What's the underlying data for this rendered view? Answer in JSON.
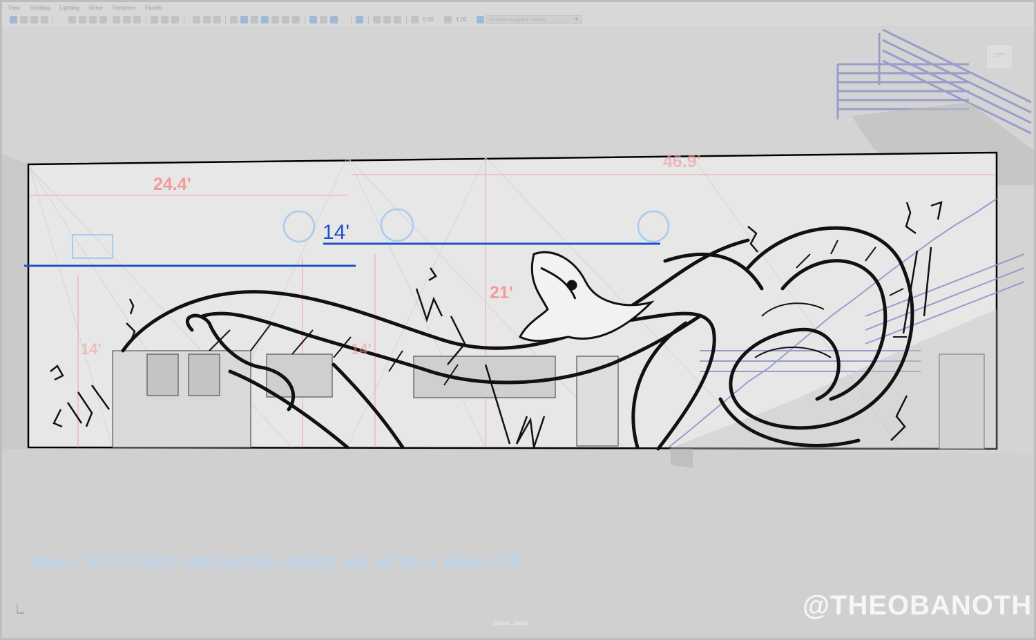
{
  "menubar": {
    "items": [
      "View",
      "Shading",
      "Lighting",
      "Show",
      "Renderer",
      "Panels"
    ]
  },
  "toolbar": {
    "exposure_value": "0.00",
    "gamma_value": "1.00",
    "color_space": "Un-tone-mapped (sRGB)"
  },
  "viewport": {
    "view_cube_label": "LEFT",
    "panel_label": "Isolate : persp",
    "dimensions": {
      "width_left": "24.4'",
      "width_right": "46.9'",
      "height_center": "21'",
      "height_left": "14'",
      "height_mid": "14'",
      "hvac_height": "14'"
    },
    "caption": "Blue - HVAC Duct intersection points are all at or above 14'",
    "watermark": "@THEOBANOTH"
  },
  "colors": {
    "hvac_blue": "#2050c8",
    "dimension_red": "#f39a9a",
    "caption_blue": "#bcd6ee",
    "stair_blue": "#8a90c8"
  }
}
